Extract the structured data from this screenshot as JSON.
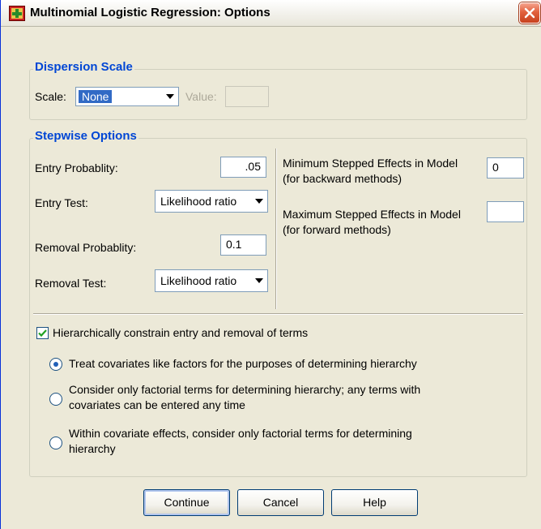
{
  "window": {
    "title": "Multinomial Logistic Regression: Options",
    "icon": "spss-dialog-icon",
    "close_icon": "close-icon"
  },
  "dispersion": {
    "legend": "Dispersion Scale",
    "scale_label": "Scale:",
    "scale_value": "None",
    "value_label": "Value:",
    "value_input": ""
  },
  "stepwise": {
    "legend": "Stepwise Options",
    "entry_probability_label": "Entry Probablity:",
    "entry_probability_value": ".05",
    "entry_test_label": "Entry Test:",
    "entry_test_value": "Likelihood ratio",
    "removal_probability_label": "Removal Probablity:",
    "removal_probability_value": "0.1",
    "removal_test_label": "Removal Test:",
    "removal_test_value": "Likelihood ratio",
    "min_effects_label": "Minimum Stepped Effects in Model",
    "min_effects_sub": "(for backward methods)",
    "min_effects_value": "0",
    "max_effects_label": "Maximum Stepped Effects in Model",
    "max_effects_sub": "(for forward methods)",
    "max_effects_value": ""
  },
  "hierarchy": {
    "checkbox_label": "Hierarchically constrain entry and removal of terms",
    "checked": true,
    "options": [
      {
        "line1": "Treat covariates like factors for the purposes of determining hierarchy",
        "line2": "",
        "selected": true
      },
      {
        "line1": "Consider only factorial terms for determining hierarchy; any terms with",
        "line2": "covariates can be entered any time",
        "selected": false
      },
      {
        "line1": "Within covariate effects, consider only factorial terms for determining",
        "line2": "hierarchy",
        "selected": false
      }
    ]
  },
  "buttons": {
    "continue": "Continue",
    "cancel": "Cancel",
    "help": "Help"
  },
  "colors": {
    "group_title": "#0046d5",
    "dialog_background": "#ece9d8",
    "close_button": "#e2613e"
  }
}
